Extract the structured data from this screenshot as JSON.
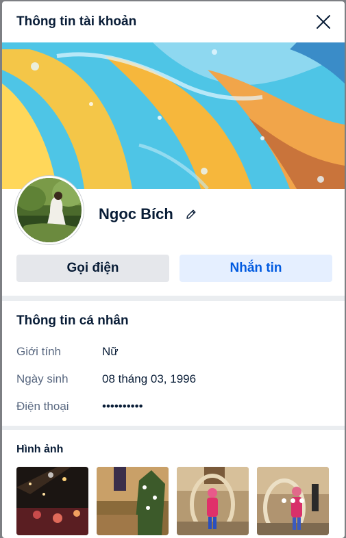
{
  "header": {
    "title": "Thông tin tài khoản"
  },
  "profile": {
    "name": "Ngọc Bích"
  },
  "actions": {
    "call_label": "Gọi điện",
    "message_label": "Nhắn tin"
  },
  "personal_info": {
    "title": "Thông tin cá nhân",
    "rows": [
      {
        "label": "Giới tính",
        "value": "Nữ"
      },
      {
        "label": "Ngày sinh",
        "value": "08 tháng 03, 1996"
      },
      {
        "label": "Điện thoại",
        "value": "••••••••••"
      }
    ]
  },
  "photos": {
    "title": "Hình ảnh",
    "count_visible": 4
  },
  "colors": {
    "accent": "#005ae0",
    "accent_bg": "#e5efff",
    "secondary_btn": "#e5e7eb",
    "divider": "#eaedf0"
  }
}
